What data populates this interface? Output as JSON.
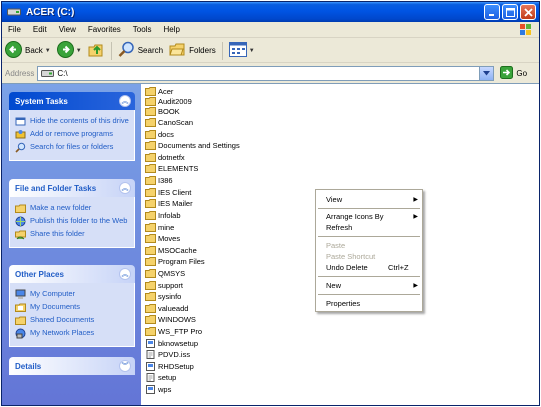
{
  "window": {
    "title": "ACER (C:)"
  },
  "menubar": {
    "items": [
      "File",
      "Edit",
      "View",
      "Favorites",
      "Tools",
      "Help"
    ]
  },
  "toolbar": {
    "back_label": "Back",
    "search_label": "Search",
    "folders_label": "Folders"
  },
  "address": {
    "label": "Address",
    "value": "C:\\",
    "go_label": "Go"
  },
  "tasks": {
    "system": {
      "title": "System Tasks",
      "items": [
        "Hide the contents of this drive",
        "Add or remove programs",
        "Search for files or folders"
      ]
    },
    "file_folder": {
      "title": "File and Folder Tasks",
      "items": [
        "Make a new folder",
        "Publish this folder to the Web",
        "Share this folder"
      ]
    },
    "other": {
      "title": "Other Places",
      "items": [
        "My Computer",
        "My Documents",
        "Shared Documents",
        "My Network Places"
      ]
    },
    "details": {
      "title": "Details"
    }
  },
  "files": [
    {
      "name": "Acer",
      "kind": "folder"
    },
    {
      "name": "Audit2009",
      "kind": "folder"
    },
    {
      "name": "BOOK",
      "kind": "folder"
    },
    {
      "name": "CanoScan",
      "kind": "folder"
    },
    {
      "name": "docs",
      "kind": "folder"
    },
    {
      "name": "Documents and Settings",
      "kind": "folder"
    },
    {
      "name": "dotnetfx",
      "kind": "folder"
    },
    {
      "name": "ELEMENTS",
      "kind": "folder"
    },
    {
      "name": "I386",
      "kind": "folder"
    },
    {
      "name": "IES Client",
      "kind": "folder"
    },
    {
      "name": "IES Mailer",
      "kind": "folder"
    },
    {
      "name": "Infolab",
      "kind": "folder"
    },
    {
      "name": "mine",
      "kind": "folder"
    },
    {
      "name": "Moves",
      "kind": "folder"
    },
    {
      "name": "MSOCache",
      "kind": "folder"
    },
    {
      "name": "Program Files",
      "kind": "folder"
    },
    {
      "name": "QMSYS",
      "kind": "folder"
    },
    {
      "name": "support",
      "kind": "folder"
    },
    {
      "name": "sysinfo",
      "kind": "folder"
    },
    {
      "name": "valueadd",
      "kind": "folder"
    },
    {
      "name": "WINDOWS",
      "kind": "folder"
    },
    {
      "name": "WS_FTP Pro",
      "kind": "folder"
    },
    {
      "name": "bknowsetup",
      "kind": "file"
    },
    {
      "name": "PDVD.iss",
      "kind": "file"
    },
    {
      "name": "RHDSetup",
      "kind": "file"
    },
    {
      "name": "setup",
      "kind": "file"
    },
    {
      "name": "wps",
      "kind": "file"
    }
  ],
  "context_menu": {
    "view": "View",
    "arrange": "Arrange Icons By",
    "refresh": "Refresh",
    "paste": "Paste",
    "paste_shortcut": "Paste Shortcut",
    "undo_delete": "Undo Delete",
    "undo_shortcut": "Ctrl+Z",
    "new": "New",
    "properties": "Properties"
  },
  "colors": {
    "titlebar": "#0054e3",
    "taskpane": "#6375d6",
    "link": "#215dc6",
    "folder": "#f5d26b"
  }
}
